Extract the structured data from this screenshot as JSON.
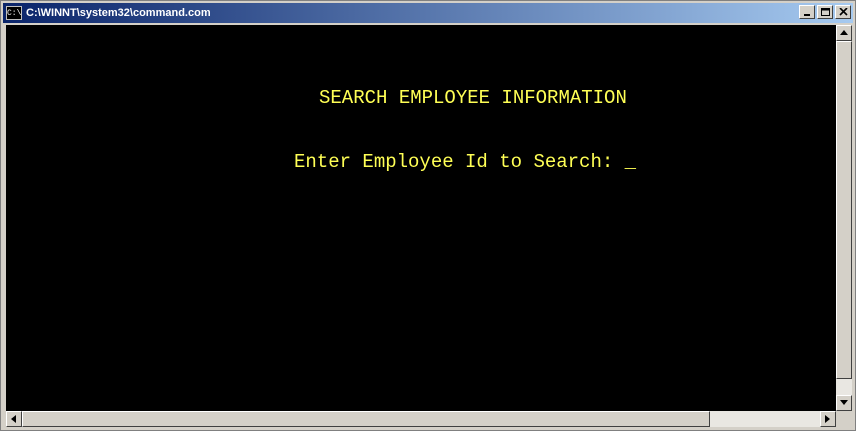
{
  "window": {
    "title": "C:\\WINNT\\system32\\command.com",
    "icon_text": "C:\\",
    "buttons": [
      "minimize-icon",
      "maximize-icon",
      "close-icon"
    ]
  },
  "console": {
    "heading": "SEARCH EMPLOYEE INFORMATION",
    "prompt": "Enter Employee Id to Search: ",
    "cursor": "_",
    "text_color": "#ffff55",
    "background": "#000000"
  }
}
